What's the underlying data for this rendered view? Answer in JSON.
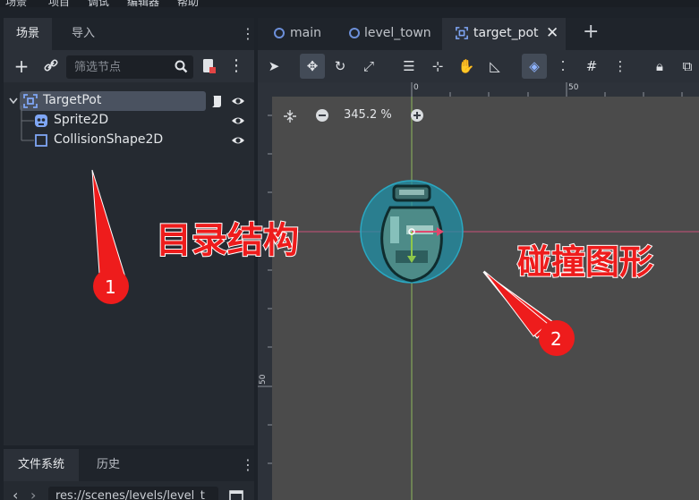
{
  "menubar": {
    "items": [
      "场景",
      "项目",
      "调试",
      "编辑器",
      "帮助"
    ]
  },
  "scene_dock": {
    "tabs": [
      {
        "label": "场景",
        "active": true
      },
      {
        "label": "导入",
        "active": false
      }
    ],
    "filter_placeholder": "筛选节点",
    "tree": [
      {
        "label": "TargetPot",
        "icon": "node2d-icon",
        "selected": true
      },
      {
        "label": "Sprite2D",
        "icon": "sprite2d-icon",
        "selected": false
      },
      {
        "label": "CollisionShape2D",
        "icon": "collision-shape-icon",
        "selected": false
      }
    ]
  },
  "filesystem_dock": {
    "tabs": [
      {
        "label": "文件系统",
        "active": true
      },
      {
        "label": "历史",
        "active": false
      }
    ],
    "path": "res://scenes/levels/level_t"
  },
  "editor_tabs": [
    {
      "label": "main",
      "icon": "scene-ring-icon",
      "active": false
    },
    {
      "label": "level_town",
      "icon": "scene-ring-icon",
      "active": false
    },
    {
      "label": "target_pot",
      "icon": "node2d-icon",
      "active": true
    }
  ],
  "viewport": {
    "zoom": "345.2 %",
    "ruler_top_labels": [
      "0",
      "50"
    ],
    "ruler_left_labels": [
      "50"
    ]
  },
  "annotations": {
    "label1": "目录结构",
    "label2": "碰撞图形",
    "marker1": "1",
    "marker2": "2"
  },
  "colors": {
    "accent_red": "#ee1c1c",
    "selection_blue": "#5b8dee",
    "collision_fill": "#1f8fa6"
  }
}
